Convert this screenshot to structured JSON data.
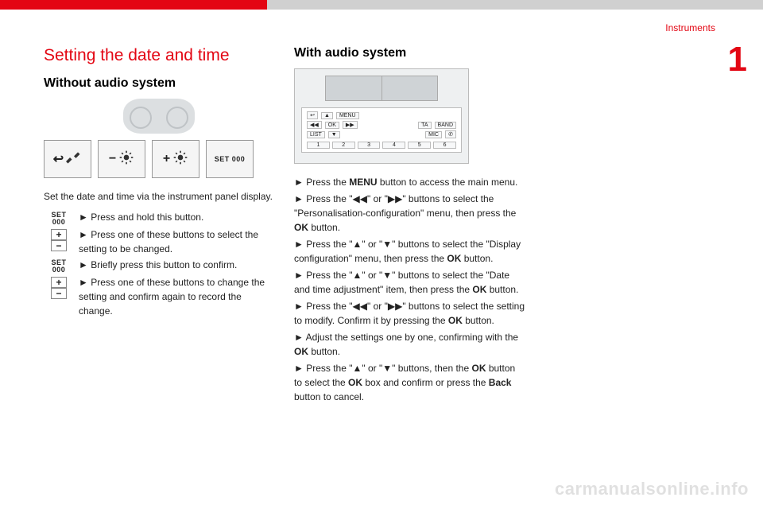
{
  "header": {
    "breadcrumb": "Instruments",
    "chapter_number": "1"
  },
  "section_title": "Setting the date and time",
  "col1": {
    "heading": "Without audio system",
    "buttons": {
      "back_icon": "↩",
      "wrench_icon": "🔧",
      "minus": "−",
      "plus": "+",
      "set_label": "SET  000"
    },
    "intro": "Set the date and time via the instrument panel display.",
    "steps": [
      {
        "icon": "SET  000",
        "text": "Press and hold this button."
      },
      {
        "icon": "pm",
        "text": "Press one of these buttons to select the setting to be changed."
      },
      {
        "icon": "SET  000",
        "text": "Briefly press this button to confirm."
      },
      {
        "icon": "pm",
        "text": "Press one of these buttons to change the setting and confirm again to record the change."
      }
    ]
  },
  "col2": {
    "heading": "With audio system",
    "radio_labels": {
      "menu": "MENU",
      "ok": "OK",
      "list": "LIST",
      "ta": "TA",
      "band": "BAND",
      "mic": "MIC",
      "presets": [
        "1",
        "2",
        "3",
        "4",
        "5",
        "6"
      ]
    },
    "bullets": [
      {
        "pre": "Press the ",
        "bold": "MENU",
        "post": " button to access the main menu."
      },
      {
        "pre": "Press the \"",
        "g1": "◀◀",
        "mid": "\" or \"",
        "g2": "▶▶",
        "post2": "\" buttons to select the \"Personalisation-configuration\" menu, then press the ",
        "bold2": "OK",
        "post3": " button."
      },
      {
        "pre": "Press the \"",
        "g1": "▲",
        "mid": "\" or \"",
        "g2": "▼",
        "post2": "\" buttons to select the \"Display configuration\" menu, then press the ",
        "bold2": "OK",
        "post3": " button."
      },
      {
        "pre": "Press the \"",
        "g1": "▲",
        "mid": "\" or \"",
        "g2": "▼",
        "post2": "\" buttons to select the \"Date and time adjustment\" item, then press the ",
        "bold2": "OK",
        "post3": " button."
      },
      {
        "pre": "Press the \"",
        "g1": "◀◀",
        "mid": "\" or \"",
        "g2": "▶▶",
        "post2": "\" buttons to select the setting to modify. Confirm it by pressing the ",
        "bold2": "OK",
        "post3": " button."
      },
      {
        "pre": "Adjust the settings one by one, confirming with the ",
        "bold": "OK",
        "post": " button."
      },
      {
        "pre": "Press the \"",
        "g1": "▲",
        "mid": "\" or \"",
        "g2": "▼",
        "post2": "\" buttons, then the ",
        "bold2": "OK",
        "post3": " button to select the ",
        "bold3": "OK",
        "post4": " box and confirm or press the ",
        "bold4": "Back",
        "post5": " button to cancel."
      }
    ]
  },
  "watermark": "carmanualsonline.info",
  "page_number": ""
}
